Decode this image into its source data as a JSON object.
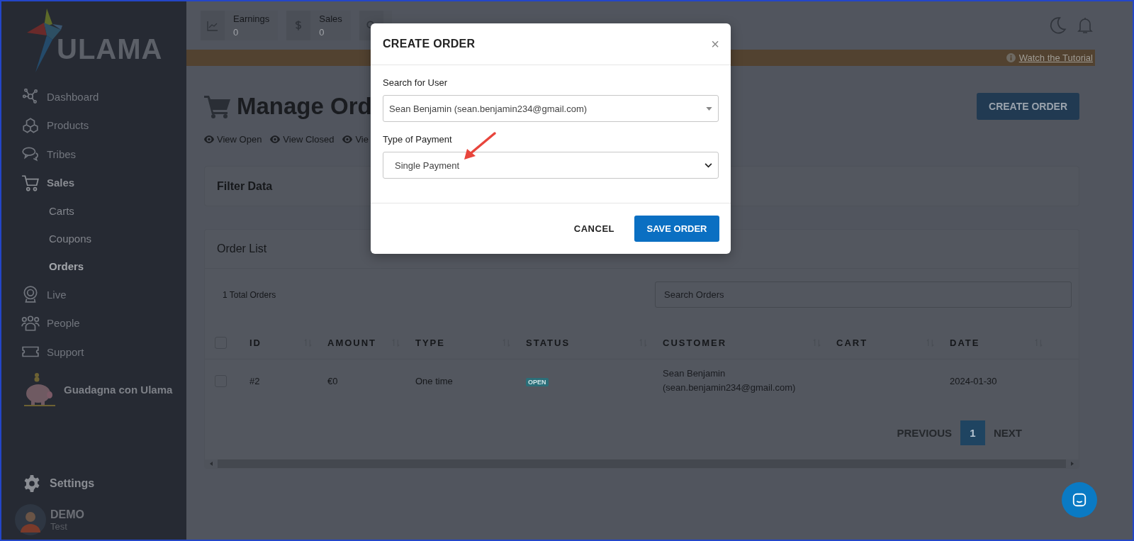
{
  "logo": {
    "text": "ULAMA"
  },
  "sidebar": {
    "items": [
      {
        "label": "Dashboard",
        "kind": "nav",
        "expanded": false
      },
      {
        "label": "Products",
        "kind": "nav",
        "expanded": false
      },
      {
        "label": "Tribes",
        "kind": "nav",
        "expanded": false
      },
      {
        "label": "Sales",
        "kind": "nav",
        "expanded": true,
        "children": [
          {
            "label": "Carts",
            "selected": false
          },
          {
            "label": "Coupons",
            "selected": false
          },
          {
            "label": "Orders",
            "selected": true
          }
        ]
      },
      {
        "label": "Live",
        "kind": "nav",
        "expanded": false
      },
      {
        "label": "People",
        "kind": "nav",
        "expanded": false
      },
      {
        "label": "Support",
        "kind": "nav",
        "expanded": false
      },
      {
        "label": "Guadagna con Ulama",
        "kind": "promo"
      }
    ],
    "settings": "Settings",
    "user": {
      "name": "DEMO",
      "role": "Test"
    }
  },
  "stats": [
    {
      "kind": "earnings",
      "label": "Earnings",
      "value": "0"
    },
    {
      "kind": "sales",
      "label": "Sales",
      "value": "0"
    },
    {
      "kind": "search"
    }
  ],
  "banner": {
    "link": "Watch the Tutorial"
  },
  "page": {
    "title": "Manage Ord",
    "create_button": "CREATE ORDER",
    "view_links": [
      "View Open",
      "View Closed",
      "Vie"
    ]
  },
  "filter": {
    "title": "Filter Data"
  },
  "order_list": {
    "title": "Order List",
    "total": "1 Total Orders",
    "search": {
      "placeholder": "Search Orders"
    },
    "all_checked": false,
    "columns": [
      "ID",
      "AMOUNT",
      "TYPE",
      "STATUS",
      "CUSTOMER",
      "CART",
      "DATE"
    ],
    "rows": [
      {
        "checked": false,
        "id": "#2",
        "amount": "€0",
        "type": "One time",
        "status": "OPEN",
        "customer": "Sean Benjamin (sean.benjamin234@gmail.com)",
        "date": "2024-01-30"
      }
    ],
    "pagination": [
      {
        "label": "PREVIOUS",
        "kind": "text",
        "selected": false
      },
      {
        "label": "1",
        "kind": "page",
        "selected": true
      },
      {
        "label": "NEXT",
        "kind": "text",
        "selected": false
      }
    ]
  },
  "modal": {
    "title": "CREATE ORDER",
    "close": "×",
    "fields": [
      {
        "label": "Search for User",
        "value": "Sean Benjamin (sean.benjamin234@gmail.com)",
        "kind": "search-select"
      },
      {
        "label": "Type of Payment",
        "value": "Single Payment",
        "kind": "select"
      }
    ],
    "buttons": [
      {
        "label": "CANCEL",
        "kind": "text"
      },
      {
        "label": "SAVE ORDER",
        "kind": "primary"
      }
    ]
  }
}
